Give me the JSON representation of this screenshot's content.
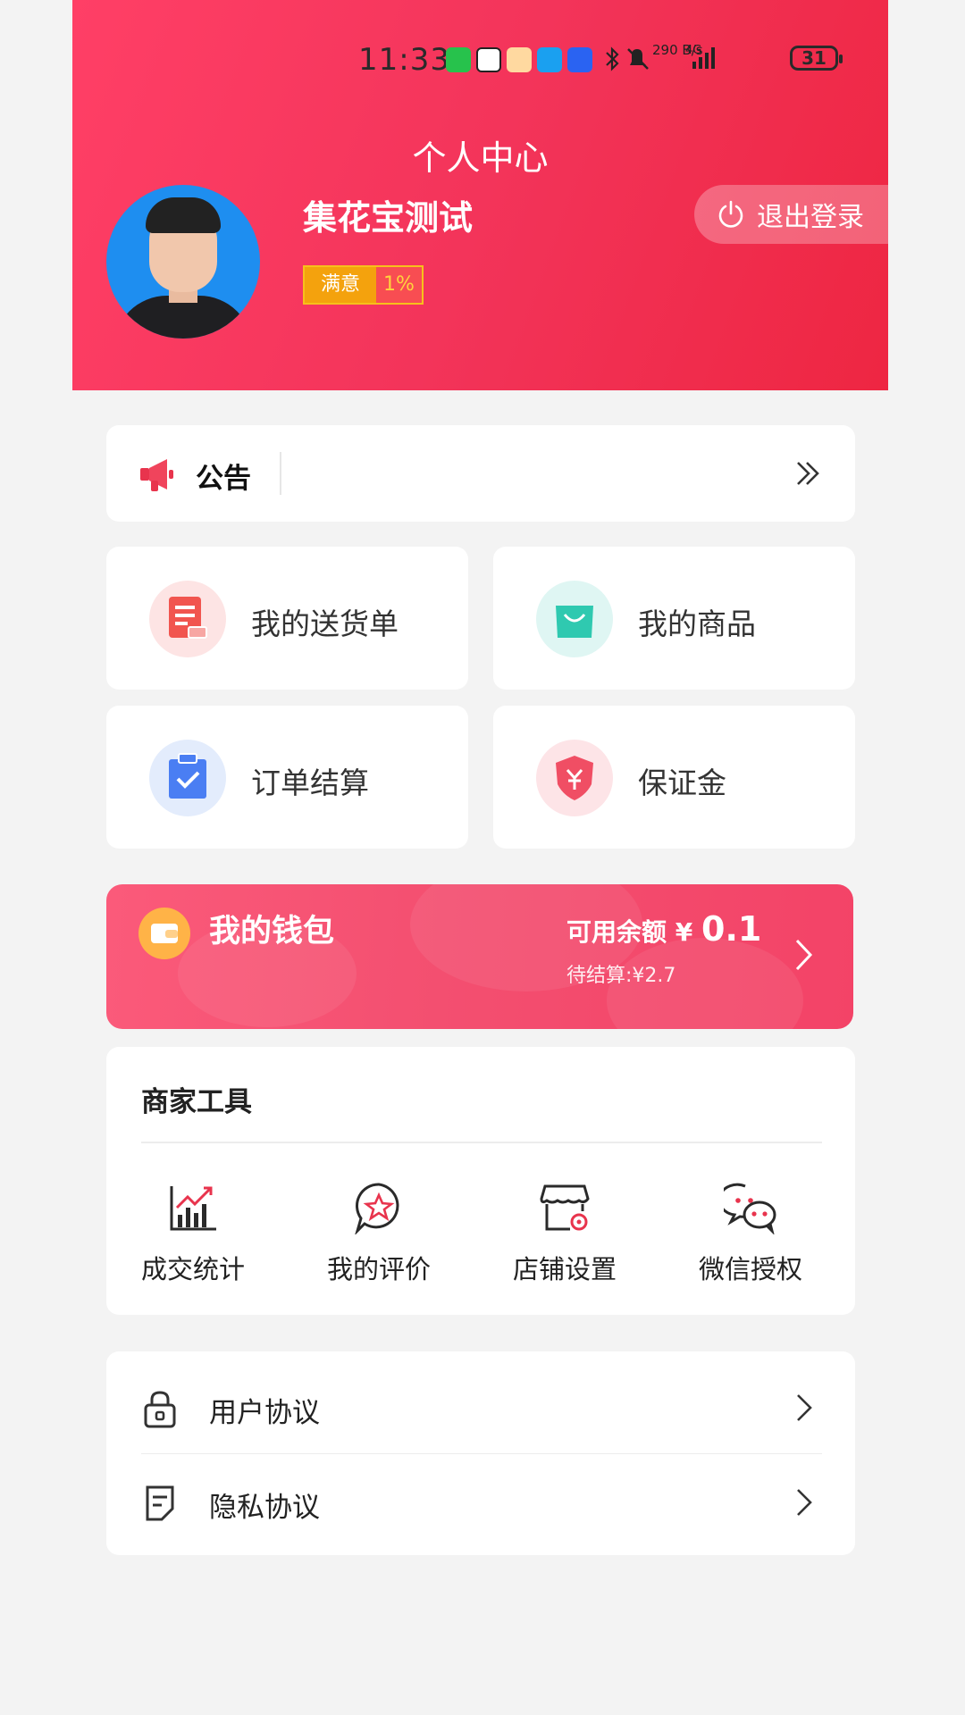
{
  "status_bar": {
    "time": "11:33",
    "net_speed": "290 B/s",
    "net_type": "4G",
    "battery": "31",
    "app_icons": [
      "wechat-icon",
      "qq-icon",
      "weather-icon",
      "search-app-icon",
      "lightbulb-app-icon"
    ]
  },
  "header": {
    "page_title": "个人中心",
    "username": "集花宝测试",
    "rating_label": "满意",
    "rating_value": "1%",
    "logout_label": "退出登录"
  },
  "notice": {
    "title": "公告"
  },
  "tiles": [
    {
      "label": "我的送货单",
      "icon": "delivery-note-icon",
      "icon_bg": "#fde4e4",
      "icon_color": "#f1554f"
    },
    {
      "label": "我的商品",
      "icon": "shopping-bag-icon",
      "icon_bg": "#dff6f3",
      "icon_color": "#2fc9b0"
    },
    {
      "label": "订单结算",
      "icon": "clipboard-check-icon",
      "icon_bg": "#e3ecfc",
      "icon_color": "#4a7ef3"
    },
    {
      "label": "保证金",
      "icon": "shield-yen-icon",
      "icon_bg": "#fde4e7",
      "icon_color": "#f04e64"
    }
  ],
  "wallet": {
    "title": "我的钱包",
    "balance_label": "可用余额",
    "currency": "¥",
    "balance": "0.1",
    "pending_label": "待结算:¥2.7"
  },
  "merchant_tools": {
    "title": "商家工具",
    "items": [
      {
        "label": "成交统计",
        "icon": "chart-trend-icon"
      },
      {
        "label": "我的评价",
        "icon": "star-chat-icon"
      },
      {
        "label": "店铺设置",
        "icon": "store-settings-icon"
      },
      {
        "label": "微信授权",
        "icon": "wechat-outline-icon"
      }
    ]
  },
  "agreements": [
    {
      "label": "用户协议",
      "icon": "lock-icon"
    },
    {
      "label": "隐私协议",
      "icon": "document-icon"
    }
  ],
  "colors": {
    "brand_red": "#f3345a",
    "accent_red": "#e8344d"
  }
}
